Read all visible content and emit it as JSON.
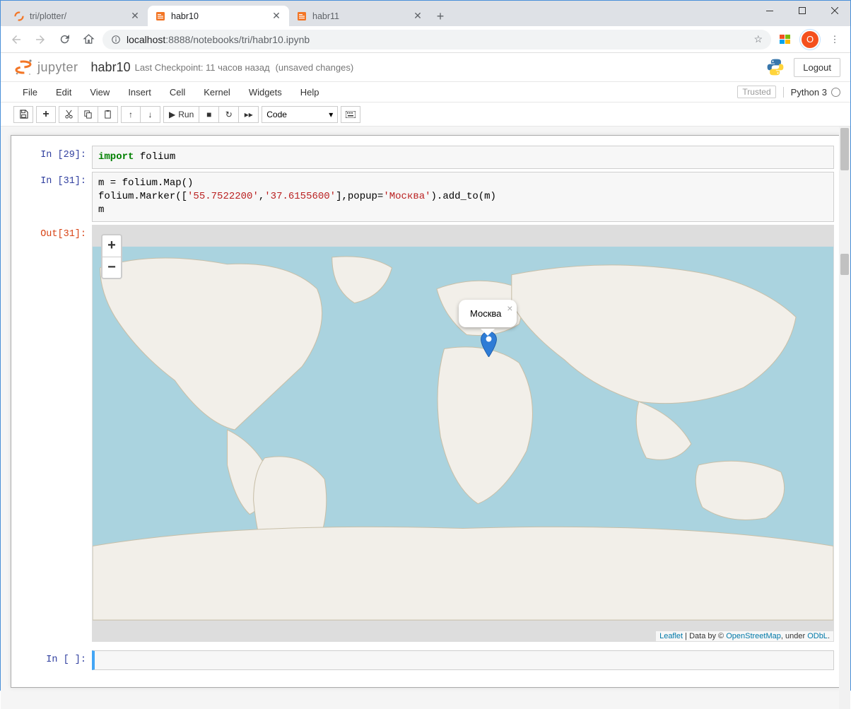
{
  "browser": {
    "tabs": [
      {
        "title": "tri/plotter/",
        "active": false,
        "favicon": "jupyter"
      },
      {
        "title": "habr10",
        "active": true,
        "favicon": "notebook"
      },
      {
        "title": "habr11",
        "active": false,
        "favicon": "notebook"
      }
    ],
    "url_host": "localhost",
    "url_port": ":8888",
    "url_path": "/notebooks/tri/habr10.ipynb",
    "avatar_letter": "O"
  },
  "jupyter": {
    "logo_text": "jupyter",
    "notebook_name": "habr10",
    "checkpoint": "Last Checkpoint: 11 часов назад",
    "autosave": "(unsaved changes)",
    "logout": "Logout",
    "trusted": "Trusted",
    "kernel": "Python 3",
    "menus": [
      "File",
      "Edit",
      "View",
      "Insert",
      "Cell",
      "Kernel",
      "Widgets",
      "Help"
    ],
    "run_label": "Run",
    "cell_type": "Code"
  },
  "cells": {
    "c1": {
      "prompt": "In [29]:",
      "code_pre": "import",
      "code_post": " folium"
    },
    "c2": {
      "prompt": "In [31]:",
      "line1a": "m = folium.Map()",
      "line2a": "folium.Marker([",
      "str1": "'55.7522200'",
      "line2b": ",",
      "str2": "'37.6155600'",
      "line2c": "],popup=",
      "str3": "'Москва'",
      "line2d": ").add_to(m)",
      "line3": "m"
    },
    "out2": {
      "prompt": "Out[31]:"
    },
    "c3": {
      "prompt": "In [ ]:"
    }
  },
  "map": {
    "popup_text": "Москва",
    "zoom_in": "+",
    "zoom_out": "−",
    "attrib_leaflet": "Leaflet",
    "attrib_mid": " | Data by © ",
    "attrib_osm": "OpenStreetMap",
    "attrib_under": ", under ",
    "attrib_odbl": "ODbL",
    "attrib_dot": "."
  }
}
